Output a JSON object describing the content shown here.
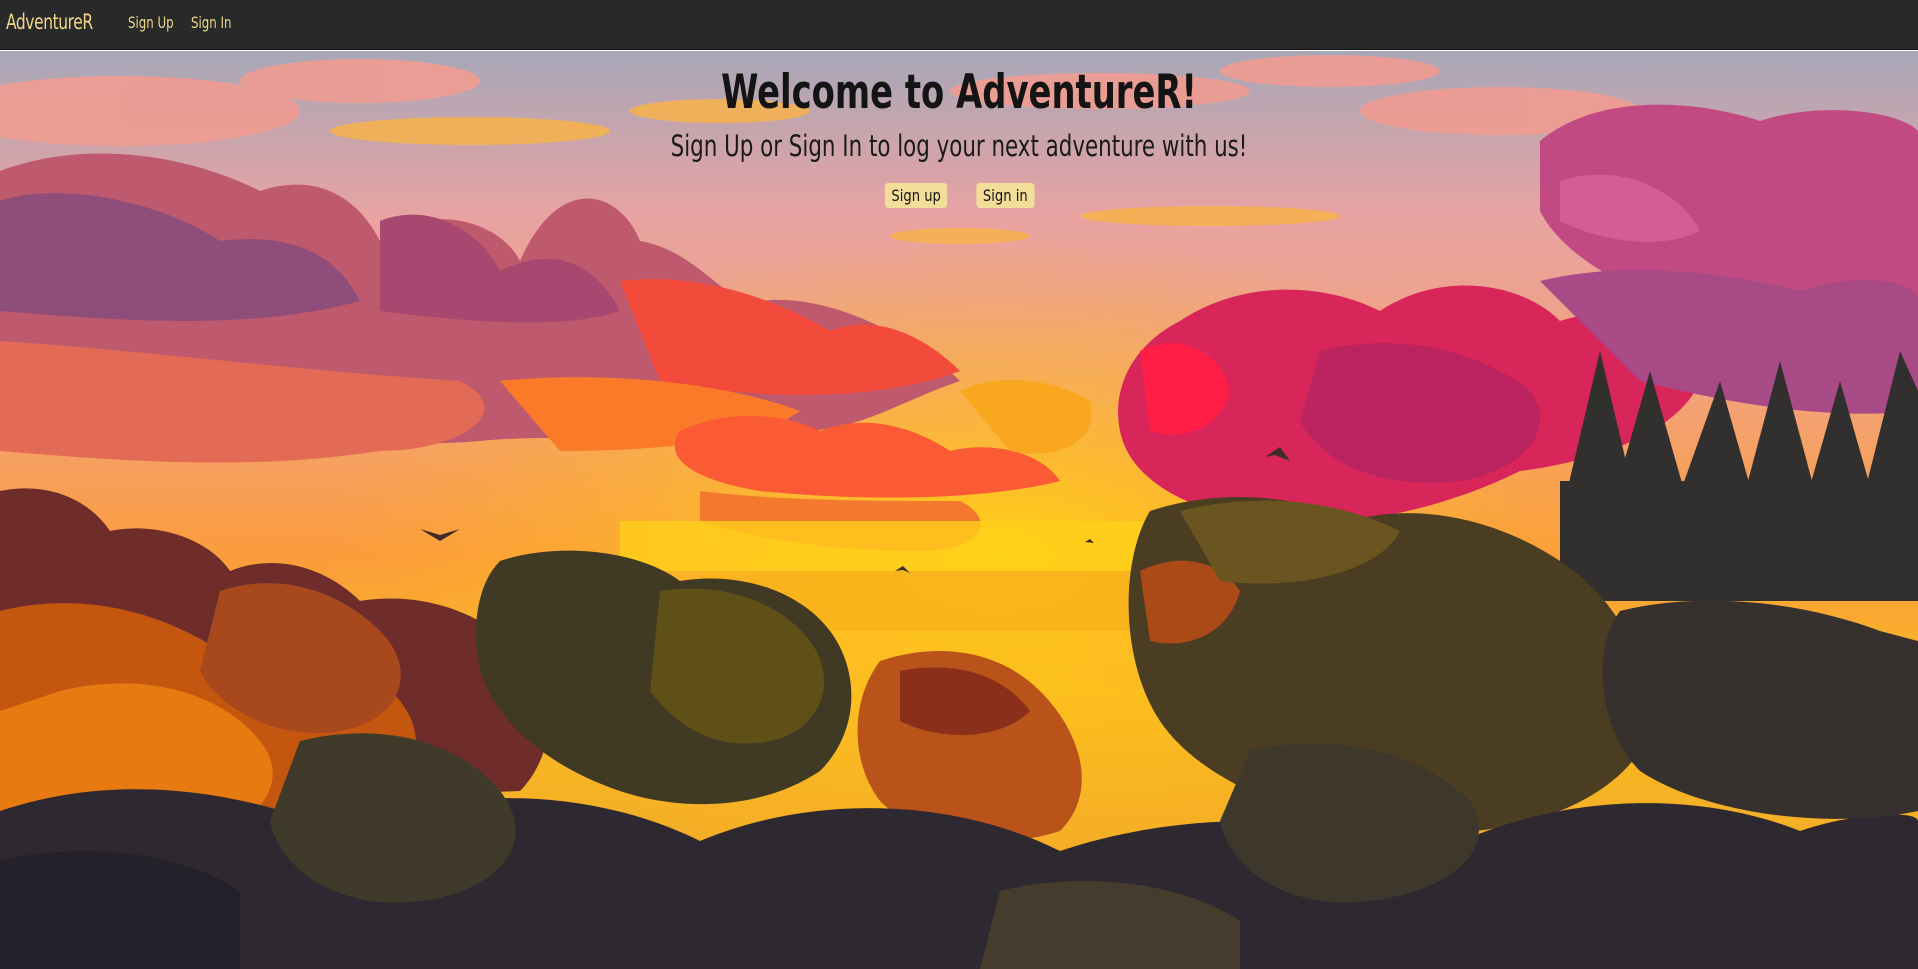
{
  "nav": {
    "brand": "AdventureR",
    "links": [
      "Sign Up",
      "Sign In"
    ]
  },
  "hero": {
    "title": "Welcome to AdventureR!",
    "subtitle": "Sign Up or Sign In to log your next adventure with us!",
    "buttons": [
      "Sign up",
      "Sign in"
    ]
  },
  "colors": {
    "navbar_bg": "#272a29",
    "accent": "#f2d58a",
    "button_bg": "#f3dd9b"
  }
}
